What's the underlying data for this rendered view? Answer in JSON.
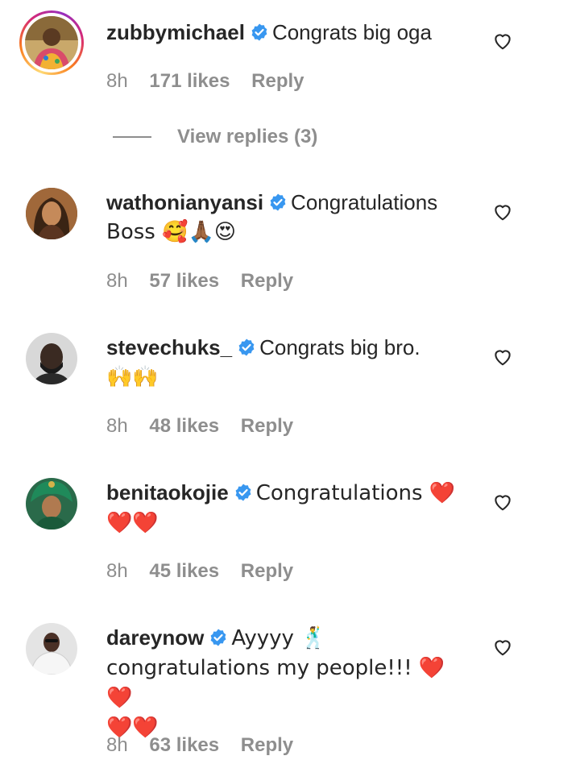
{
  "icons": {
    "verified": "verified-badge-icon",
    "like": "heart-outline-icon",
    "accent_color": "#3897f0",
    "meta_color": "#8e8e8e"
  },
  "comments": [
    {
      "username": "zubbymichael",
      "text_line1": "Congrats big oga",
      "text_line2": "",
      "text_line3": "",
      "time": "8h",
      "likes": "171 likes",
      "reply": "Reply",
      "view_replies": "View replies (3)"
    },
    {
      "username": "wathonianyansi",
      "text_line1": "Congratulations",
      "text_line2": "Boss 🥰🙏🏾😍",
      "text_line3": "",
      "time": "8h",
      "likes": "57 likes",
      "reply": "Reply"
    },
    {
      "username": "stevechuks_",
      "text_line1": "Congrats big bro.",
      "text_line2": "🙌🙌",
      "text_line3": "",
      "time": "8h",
      "likes": "48 likes",
      "reply": "Reply"
    },
    {
      "username": "benitaokojie",
      "text_line1": "Congratulations ❤️",
      "text_line2": "❤️❤️",
      "text_line3": "",
      "time": "8h",
      "likes": "45 likes",
      "reply": "Reply"
    },
    {
      "username": "dareynow",
      "text_line1": "Ayyyy 🕺",
      "text_line2": "congratulations my people!!! ❤️❤️",
      "text_line3": "❤️❤️",
      "time": "8h",
      "likes": "63 likes",
      "reply": "Reply"
    }
  ]
}
